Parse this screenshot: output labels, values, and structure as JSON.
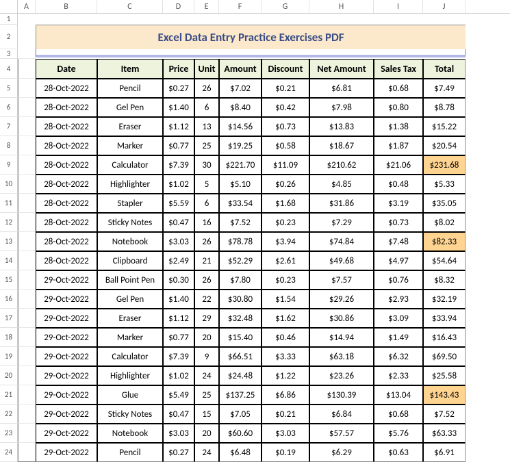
{
  "columns": [
    "A",
    "B",
    "C",
    "D",
    "E",
    "F",
    "G",
    "H",
    "I",
    "J"
  ],
  "title": "Excel Data Entry Practice Exercises PDF",
  "headers": [
    "Date",
    "Item",
    "Price",
    "Unit",
    "Amount",
    "Discount",
    "Net Amount",
    "Sales Tax",
    "Total"
  ],
  "highlight_rows": [
    4,
    8,
    16
  ],
  "rows": [
    {
      "date": "28-Oct-2022",
      "item": "Pencil",
      "price": "$0.27",
      "unit": "26",
      "amount": "$7.02",
      "discount": "$0.21",
      "net": "$6.81",
      "tax": "$0.68",
      "total": "$7.49"
    },
    {
      "date": "28-Oct-2022",
      "item": "Gel Pen",
      "price": "$1.40",
      "unit": "6",
      "amount": "$8.40",
      "discount": "$0.42",
      "net": "$7.98",
      "tax": "$0.80",
      "total": "$8.78"
    },
    {
      "date": "28-Oct-2022",
      "item": "Eraser",
      "price": "$1.12",
      "unit": "13",
      "amount": "$14.56",
      "discount": "$0.73",
      "net": "$13.83",
      "tax": "$1.38",
      "total": "$15.22"
    },
    {
      "date": "28-Oct-2022",
      "item": "Marker",
      "price": "$0.77",
      "unit": "25",
      "amount": "$19.25",
      "discount": "$0.58",
      "net": "$18.67",
      "tax": "$1.87",
      "total": "$20.54"
    },
    {
      "date": "28-Oct-2022",
      "item": "Calculator",
      "price": "$7.39",
      "unit": "30",
      "amount": "$221.70",
      "discount": "$11.09",
      "net": "$210.62",
      "tax": "$21.06",
      "total": "$231.68"
    },
    {
      "date": "28-Oct-2022",
      "item": "Highlighter",
      "price": "$1.02",
      "unit": "5",
      "amount": "$5.10",
      "discount": "$0.26",
      "net": "$4.85",
      "tax": "$0.48",
      "total": "$5.33"
    },
    {
      "date": "28-Oct-2022",
      "item": "Stapler",
      "price": "$5.59",
      "unit": "6",
      "amount": "$33.54",
      "discount": "$1.68",
      "net": "$31.86",
      "tax": "$3.19",
      "total": "$35.05"
    },
    {
      "date": "28-Oct-2022",
      "item": "Sticky Notes",
      "price": "$0.47",
      "unit": "16",
      "amount": "$7.52",
      "discount": "$0.23",
      "net": "$7.29",
      "tax": "$0.73",
      "total": "$8.02"
    },
    {
      "date": "28-Oct-2022",
      "item": "Notebook",
      "price": "$3.03",
      "unit": "26",
      "amount": "$78.78",
      "discount": "$3.94",
      "net": "$74.84",
      "tax": "$7.48",
      "total": "$82.33"
    },
    {
      "date": "28-Oct-2022",
      "item": "Clipboard",
      "price": "$2.49",
      "unit": "21",
      "amount": "$52.29",
      "discount": "$2.61",
      "net": "$49.68",
      "tax": "$4.97",
      "total": "$54.64"
    },
    {
      "date": "29-Oct-2022",
      "item": "Ball Point Pen",
      "price": "$0.30",
      "unit": "26",
      "amount": "$7.80",
      "discount": "$0.23",
      "net": "$7.57",
      "tax": "$0.76",
      "total": "$8.32"
    },
    {
      "date": "29-Oct-2022",
      "item": "Gel Pen",
      "price": "$1.40",
      "unit": "22",
      "amount": "$30.80",
      "discount": "$1.54",
      "net": "$29.26",
      "tax": "$2.93",
      "total": "$32.19"
    },
    {
      "date": "29-Oct-2022",
      "item": "Eraser",
      "price": "$1.12",
      "unit": "29",
      "amount": "$32.48",
      "discount": "$1.62",
      "net": "$30.86",
      "tax": "$3.09",
      "total": "$33.94"
    },
    {
      "date": "29-Oct-2022",
      "item": "Marker",
      "price": "$0.77",
      "unit": "20",
      "amount": "$15.40",
      "discount": "$0.46",
      "net": "$14.94",
      "tax": "$1.49",
      "total": "$16.43"
    },
    {
      "date": "29-Oct-2022",
      "item": "Calculator",
      "price": "$7.39",
      "unit": "9",
      "amount": "$66.51",
      "discount": "$3.33",
      "net": "$63.18",
      "tax": "$6.32",
      "total": "$69.50"
    },
    {
      "date": "29-Oct-2022",
      "item": "Highlighter",
      "price": "$1.02",
      "unit": "24",
      "amount": "$24.48",
      "discount": "$1.22",
      "net": "$23.26",
      "tax": "$2.33",
      "total": "$25.58"
    },
    {
      "date": "29-Oct-2022",
      "item": "Glue",
      "price": "$5.49",
      "unit": "25",
      "amount": "$137.25",
      "discount": "$6.86",
      "net": "$130.39",
      "tax": "$13.04",
      "total": "$143.43"
    },
    {
      "date": "29-Oct-2022",
      "item": "Sticky Notes",
      "price": "$0.47",
      "unit": "15",
      "amount": "$7.05",
      "discount": "$0.21",
      "net": "$6.84",
      "tax": "$0.68",
      "total": "$7.52"
    },
    {
      "date": "29-Oct-2022",
      "item": "Notebook",
      "price": "$3.03",
      "unit": "20",
      "amount": "$60.60",
      "discount": "$3.03",
      "net": "$57.57",
      "tax": "$5.76",
      "total": "$63.33"
    },
    {
      "date": "29-Oct-2022",
      "item": "Pencil",
      "price": "$0.27",
      "unit": "24",
      "amount": "$6.48",
      "discount": "$0.19",
      "net": "$6.29",
      "tax": "$0.63",
      "total": "$6.91"
    }
  ]
}
